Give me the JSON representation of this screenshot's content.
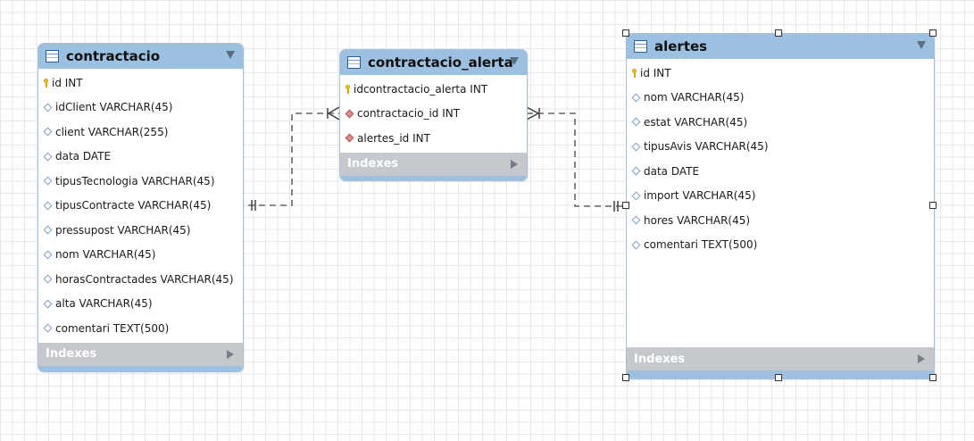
{
  "tables": {
    "contractacio": {
      "title": "contractacio",
      "columns": [
        {
          "text": "id INT",
          "kind": "pk"
        },
        {
          "text": "idClient VARCHAR(45)",
          "kind": "field"
        },
        {
          "text": "client VARCHAR(255)",
          "kind": "field"
        },
        {
          "text": "data DATE",
          "kind": "field"
        },
        {
          "text": "tipusTecnologia VARCHAR(45)",
          "kind": "field"
        },
        {
          "text": "tipusContracte VARCHAR(45)",
          "kind": "field"
        },
        {
          "text": "pressupost VARCHAR(45)",
          "kind": "field"
        },
        {
          "text": "nom VARCHAR(45)",
          "kind": "field"
        },
        {
          "text": "horasContractades VARCHAR(45)",
          "kind": "field"
        },
        {
          "text": "alta VARCHAR(45)",
          "kind": "field"
        },
        {
          "text": "comentari TEXT(500)",
          "kind": "field"
        }
      ],
      "indexes_label": "Indexes"
    },
    "contractacio_alerta": {
      "title": "contractacio_alerta",
      "columns": [
        {
          "text": "idcontractacio_alerta INT",
          "kind": "pk"
        },
        {
          "text": "contractacio_id INT",
          "kind": "fk"
        },
        {
          "text": "alertes_id INT",
          "kind": "fk"
        }
      ],
      "indexes_label": "Indexes"
    },
    "alertes": {
      "title": "alertes",
      "columns": [
        {
          "text": "id INT",
          "kind": "pk"
        },
        {
          "text": "nom VARCHAR(45)",
          "kind": "field"
        },
        {
          "text": "estat VARCHAR(45)",
          "kind": "field"
        },
        {
          "text": "tipusAvis VARCHAR(45)",
          "kind": "field"
        },
        {
          "text": "data DATE",
          "kind": "field"
        },
        {
          "text": "import VARCHAR(45)",
          "kind": "field"
        },
        {
          "text": "hores VARCHAR(45)",
          "kind": "field"
        },
        {
          "text": "comentari TEXT(500)",
          "kind": "field"
        }
      ],
      "indexes_label": "Indexes"
    }
  },
  "relationships": [
    {
      "from": "contractacio",
      "to": "contractacio_alerta",
      "from_cardinality": "one",
      "to_cardinality": "many"
    },
    {
      "from": "contractacio_alerta",
      "to": "alertes",
      "from_cardinality": "many",
      "to_cardinality": "one"
    }
  ],
  "selected_table": "alertes",
  "colors": {
    "header": "#9cc0df",
    "indexes_bar": "#c5c8cc",
    "connector": "#666666",
    "grid": "#e6e9ee"
  }
}
